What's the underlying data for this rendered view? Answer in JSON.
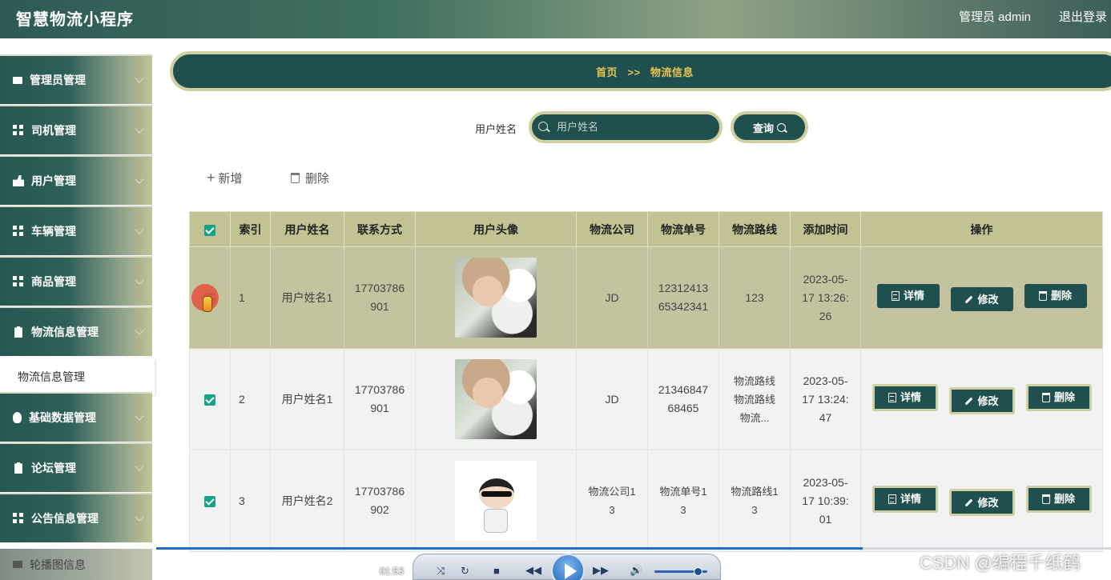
{
  "header": {
    "app_title": "智慧物流小程序",
    "user_label": "管理员 admin",
    "logout_label": "退出登录"
  },
  "sidebar": {
    "items": [
      {
        "label": "管理员管理",
        "icon": "monitor-icon"
      },
      {
        "label": "司机管理",
        "icon": "grid-icon"
      },
      {
        "label": "用户管理",
        "icon": "user-icon"
      },
      {
        "label": "车辆管理",
        "icon": "grid-icon"
      },
      {
        "label": "商品管理",
        "icon": "grid-icon"
      },
      {
        "label": "物流信息管理",
        "icon": "clipboard-icon"
      },
      {
        "label": "基础数据管理",
        "icon": "bulb-icon"
      },
      {
        "label": "论坛管理",
        "icon": "clipboard-check-icon"
      },
      {
        "label": "公告信息管理",
        "icon": "grid-icon"
      },
      {
        "label": "轮播图信息",
        "icon": "monitor-icon"
      }
    ],
    "active_subitem": "物流信息管理"
  },
  "breadcrumb": {
    "home": "首页",
    "sep": ">>",
    "current": "物流信息"
  },
  "search": {
    "label": "用户姓名",
    "placeholder": "用户姓名",
    "button": "查询"
  },
  "toolbar": {
    "add": "新增",
    "delete": "删除"
  },
  "table": {
    "headers": [
      "索引",
      "用户姓名",
      "联系方式",
      "用户头像",
      "物流公司",
      "物流单号",
      "物流路线",
      "添加时间",
      "操作"
    ],
    "rows": [
      {
        "index": "1",
        "name": "用户姓名1",
        "phone_a": "17703786",
        "phone_b": "901",
        "company_a": "JD",
        "company_b": "",
        "order_a": "12312413",
        "order_b": "65342341",
        "route_a": "123",
        "route_b": "",
        "route_c": "",
        "time_a": "2023-05-",
        "time_b": "17 13:26:",
        "time_c": "26"
      },
      {
        "index": "2",
        "name": "用户姓名1",
        "phone_a": "17703786",
        "phone_b": "901",
        "company_a": "JD",
        "company_b": "",
        "order_a": "21346847",
        "order_b": "68465",
        "route_a": "物流路线",
        "route_b": "物流路线",
        "route_c": "物流...",
        "time_a": "2023-05-",
        "time_b": "17 13:24:",
        "time_c": "47"
      },
      {
        "index": "3",
        "name": "用户姓名2",
        "phone_a": "17703786",
        "phone_b": "902",
        "company_a": "物流公司1",
        "company_b": "3",
        "order_a": "物流单号1",
        "order_b": "3",
        "route_a": "物流路线1",
        "route_b": "3",
        "route_c": "",
        "time_a": "2023-05-",
        "time_b": "17 10:39:",
        "time_c": "01"
      }
    ],
    "actions": {
      "detail": "详情",
      "edit": "修改",
      "delete": "删除"
    }
  },
  "player": {
    "time": "01:53",
    "progress": 0.74
  },
  "watermark": "CSDN @编程千纸鹤"
}
